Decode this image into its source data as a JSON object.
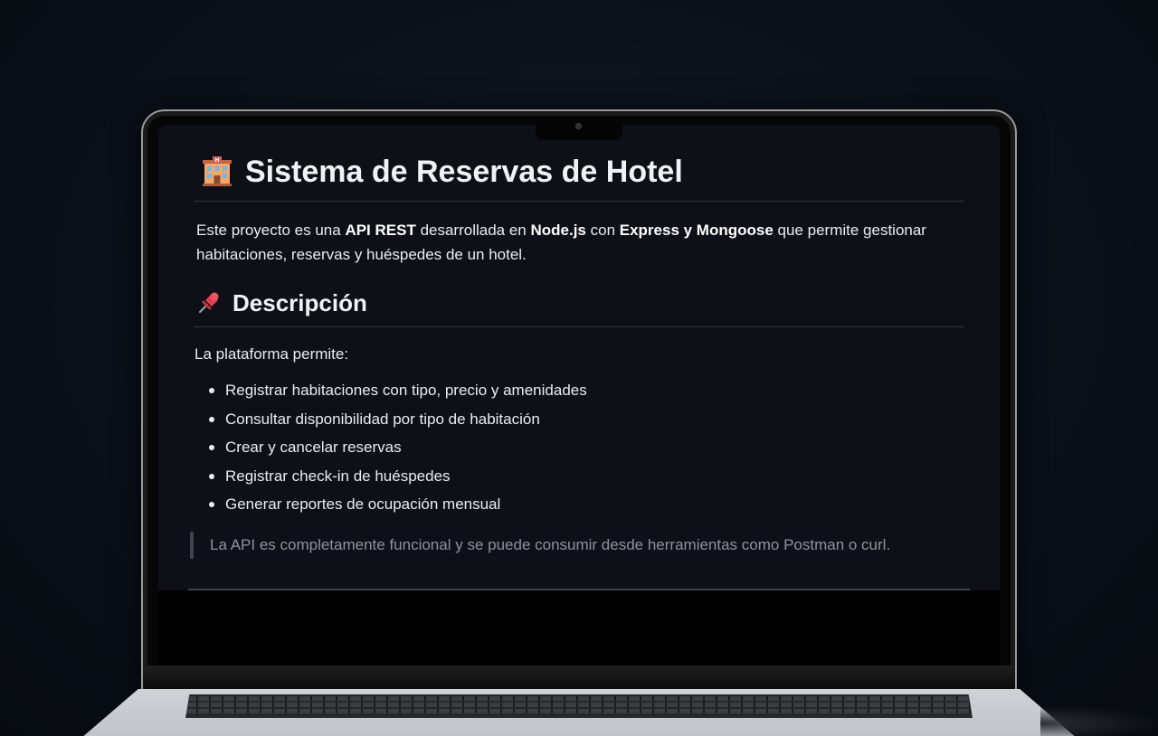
{
  "readme": {
    "title": "Sistema de Reservas de Hotel",
    "title_icon": "hotel-icon",
    "intro": {
      "part1": "Este proyecto es una ",
      "bold1": "API REST",
      "part2": " desarrollada en ",
      "bold2": "Node.js",
      "part3": " con ",
      "bold3": "Express y Mongoose",
      "part4": " que permite gestionar habitaciones, reservas y huéspedes de un hotel."
    },
    "section_title": "Descripción",
    "section_icon": "pushpin-icon",
    "lead": "La plataforma permite:",
    "features": [
      "Registrar habitaciones con tipo, precio y amenidades",
      "Consultar disponibilidad por tipo de habitación",
      "Crear y cancelar reservas",
      "Registrar check-in de huéspedes",
      "Generar reportes de ocupación mensual"
    ],
    "quote": "La API es completamente funcional y se puede consumir desde herramientas como Postman o curl."
  },
  "colors": {
    "background": "#0d1117",
    "text": "#e6edf3",
    "muted": "#8b949e",
    "divider": "#30363d"
  }
}
